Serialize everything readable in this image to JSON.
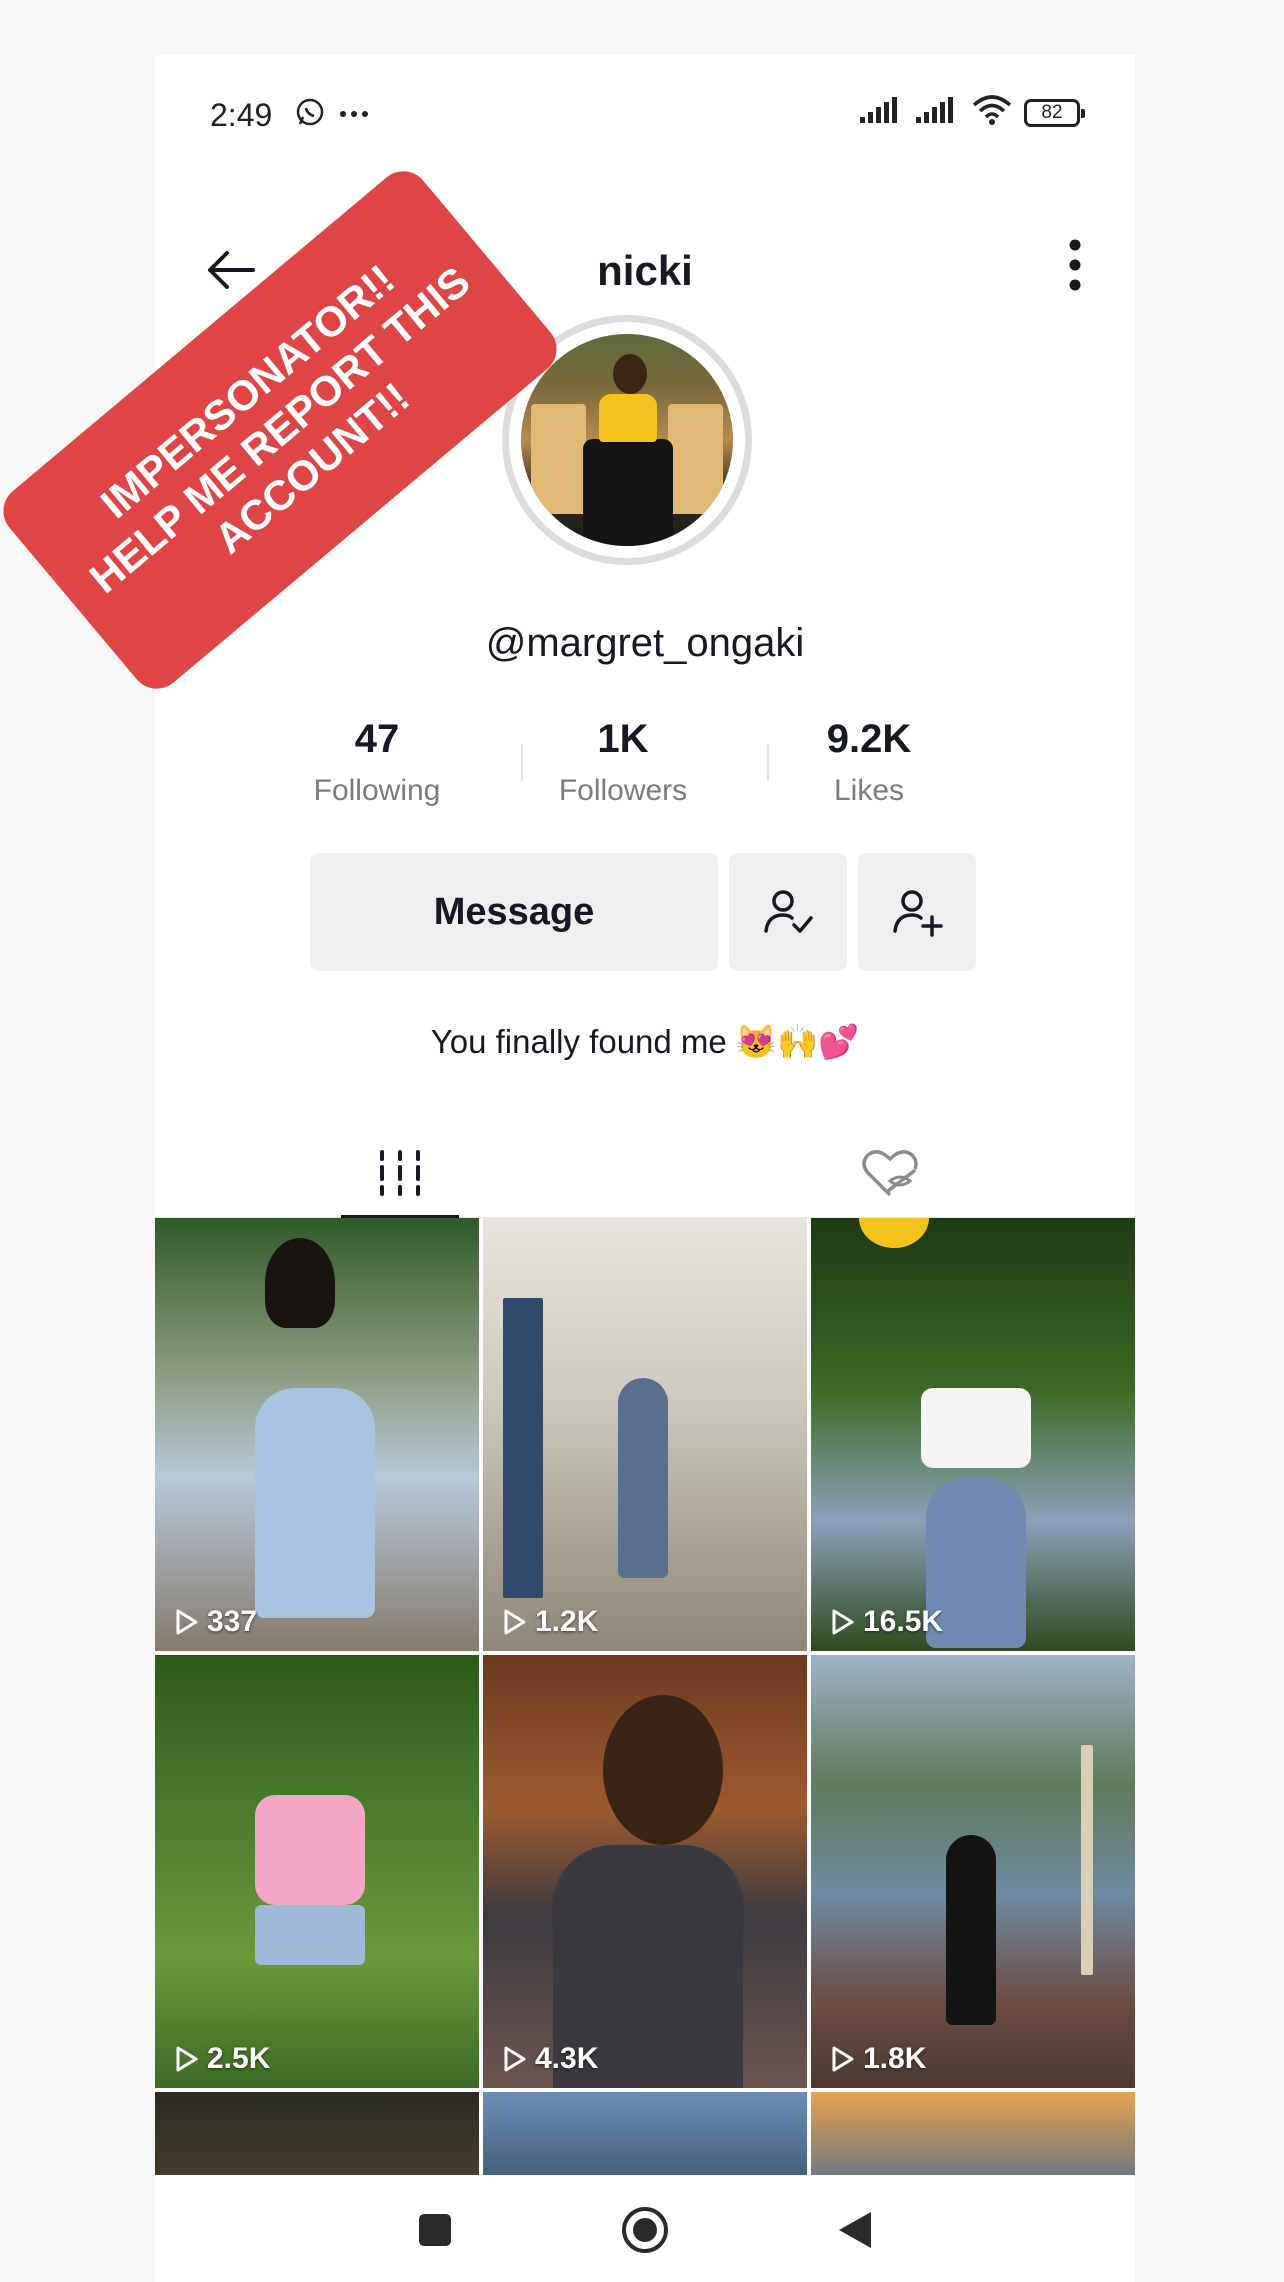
{
  "status_bar": {
    "time": "2:49",
    "battery": "82"
  },
  "header": {
    "title": "nicki"
  },
  "profile": {
    "username": "@margret_ongaki",
    "bio": "You finally found me 😻🙌💕",
    "stats": [
      {
        "value": "47",
        "label": "Following"
      },
      {
        "value": "1K",
        "label": "Followers"
      },
      {
        "value": "9.2K",
        "label": "Likes"
      }
    ]
  },
  "actions": {
    "message_label": "Message"
  },
  "tabs": [
    {
      "icon": "videos-grid-icon",
      "active": true
    },
    {
      "icon": "private-liked-icon",
      "active": false
    }
  ],
  "videos": [
    {
      "views": "337"
    },
    {
      "views": "1.2K"
    },
    {
      "views": "16.5K"
    },
    {
      "views": "2.5K"
    },
    {
      "views": "4.3K"
    },
    {
      "views": "1.8K"
    }
  ],
  "overlay": {
    "sticker_text": "IMPERSONATOR!!\nHELP ME REPORT THIS\nACCOUNT!!",
    "color": "#e04545"
  }
}
